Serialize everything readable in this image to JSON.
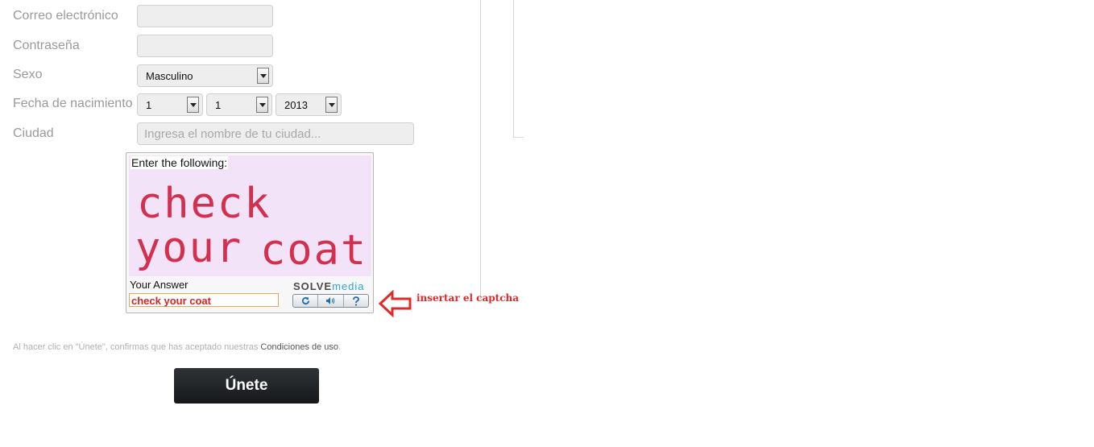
{
  "form": {
    "email_label": "Correo electrónico",
    "email_value": "",
    "password_label": "Contraseña",
    "password_value": "",
    "sex_label": "Sexo",
    "sex_value": "Masculino",
    "birthdate_label": "Fecha de nacimiento",
    "birth_day": "1",
    "birth_month": "1",
    "birth_year": "2013",
    "city_label": "Ciudad",
    "city_placeholder": "Ingresa el nombre de tu ciudad..."
  },
  "captcha": {
    "instruction": "Enter the following:",
    "line1": "check",
    "line2_a": "your",
    "line2_b": "coat",
    "answer_label": "Your Answer",
    "answer_value": "check your coat",
    "brand_a": "SOLVE",
    "brand_b": "media",
    "buttons": [
      "refresh-icon",
      "audio-icon",
      "help-icon"
    ],
    "text_color": "#d3304e",
    "bg_color": "#f3e3f8"
  },
  "annotation": {
    "text": "insertar el captcha",
    "color": "#e02a2a"
  },
  "terms": {
    "prefix": "Al hacer clic en \"Únete\", confirmas que has aceptado nuestras ",
    "link": "Condiciones de uso",
    "suffix": "."
  },
  "join_button": "Únete"
}
